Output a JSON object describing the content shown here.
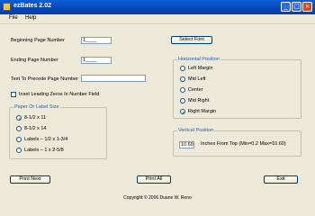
{
  "window": {
    "title": "ezBates 2.02",
    "minimize_icon": "minimize-icon",
    "maximize_icon": "maximize-icon",
    "close_icon": "close-icon",
    "min_glyph": "_",
    "max_glyph": "□",
    "close_glyph": "×"
  },
  "menu": {
    "items": [
      "File",
      "Help"
    ]
  },
  "fields": {
    "beginning_label": "Beginning Page Number",
    "beginning_value": "1____",
    "ending_label": "Ending Page Number",
    "ending_value": "1____",
    "text_label": "Text To Precede Page Number",
    "text_value": "",
    "leading_zeros_label": "Inset Leading Zeros In Number Field",
    "leading_zeros_checked": false
  },
  "paper_size": {
    "title": "Paper Or Label Size",
    "options": [
      "8-1/2 x 11",
      "8-1/2 x 14",
      "Labels – 1/2 x 1-3/4",
      "Labels – 1 x 2-5/8"
    ],
    "selected": "8-1/2 x 11"
  },
  "buttons": {
    "select_font": "Select Font",
    "print_next": "Print Next",
    "print_all": "Print All",
    "exit": "Exit"
  },
  "horizontal": {
    "title": "Horizontal Position",
    "options": [
      "Left Margin",
      "Mid Left",
      "Center",
      "Mid Right",
      "Right Margin"
    ],
    "selected": "Right Margin"
  },
  "vertical": {
    "title": "Vertical Position",
    "value": "10.60",
    "caption": "Inches From Top (Min=0.2 Max=10.60)"
  },
  "footer": {
    "copyright": "Copyright © 2006 Duane W. Reno"
  }
}
